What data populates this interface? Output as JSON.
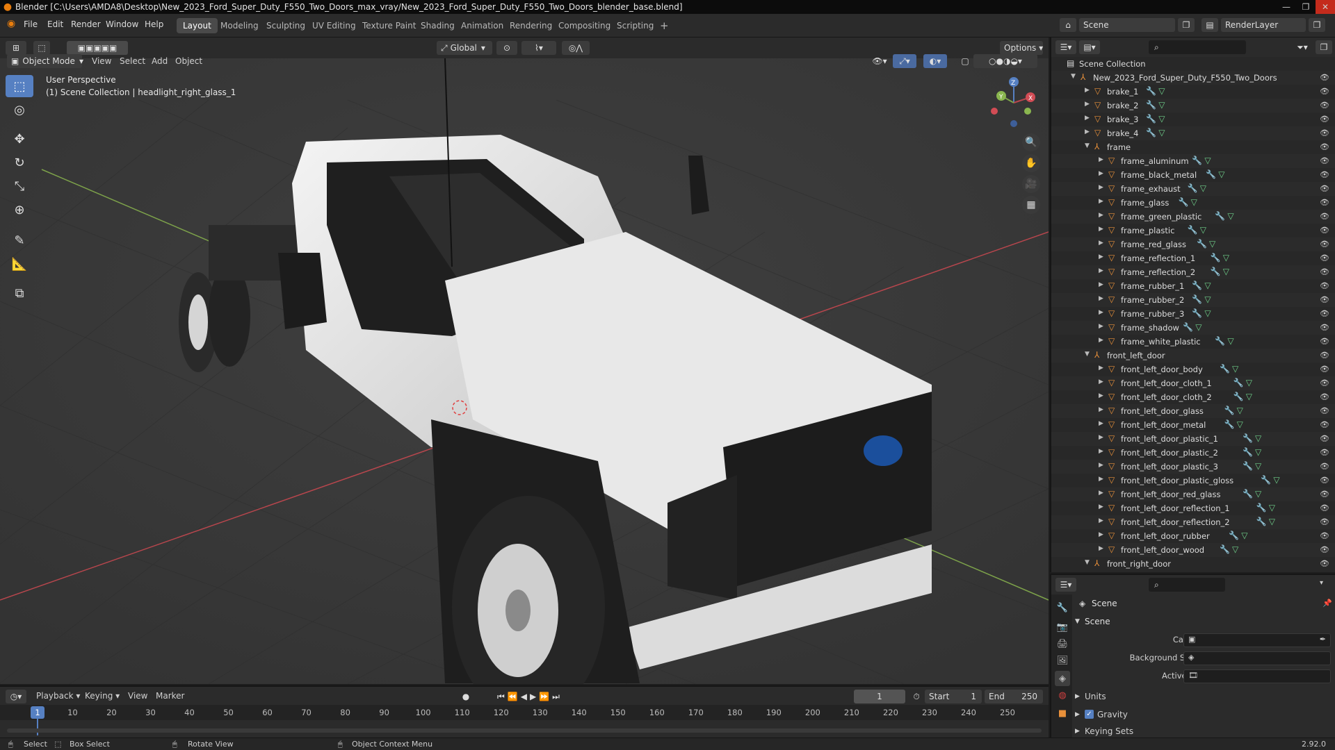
{
  "window": {
    "title": "Blender [C:\\Users\\AMDA8\\Desktop\\New_2023_Ford_Super_Duty_F550_Two_Doors_max_vray/New_2023_Ford_Super_Duty_F550_Two_Doors_blender_base.blend]"
  },
  "menu": [
    "File",
    "Edit",
    "Render",
    "Window",
    "Help"
  ],
  "workspaces": [
    "Layout",
    "Modeling",
    "Sculpting",
    "UV Editing",
    "Texture Paint",
    "Shading",
    "Animation",
    "Rendering",
    "Compositing",
    "Scripting"
  ],
  "active_workspace": "Layout",
  "topright": {
    "scene": "Scene",
    "render_layer": "RenderLayer"
  },
  "viewport_header": {
    "orientation": "Global",
    "options": "Options",
    "mode": "Object Mode",
    "menus": [
      "View",
      "Select",
      "Add",
      "Object"
    ]
  },
  "viewport": {
    "perspective": "User Perspective",
    "context": "(1) Scene Collection | headlight_right_glass_1"
  },
  "gizmo": {
    "x": "X",
    "y": "Y",
    "z": "Z"
  },
  "outliner": {
    "root": "Scene Collection",
    "collection": "New_2023_Ford_Super_Duty_F550_Two_Doors",
    "brakes": [
      "brake_1",
      "brake_2",
      "brake_3",
      "brake_4"
    ],
    "frame": {
      "name": "frame",
      "children": [
        "frame_aluminum",
        "frame_black_metal",
        "frame_exhaust",
        "frame_glass",
        "frame_green_plastic",
        "frame_plastic",
        "frame_red_glass",
        "frame_reflection_1",
        "frame_reflection_2",
        "frame_rubber_1",
        "frame_rubber_2",
        "frame_rubber_3",
        "frame_shadow",
        "frame_white_plastic"
      ]
    },
    "front_left_door": {
      "name": "front_left_door",
      "children": [
        "front_left_door_body",
        "front_left_door_cloth_1",
        "front_left_door_cloth_2",
        "front_left_door_glass",
        "front_left_door_metal",
        "front_left_door_plastic_1",
        "front_left_door_plastic_2",
        "front_left_door_plastic_3",
        "front_left_door_plastic_gloss",
        "front_left_door_red_glass",
        "front_left_door_reflection_1",
        "front_left_door_reflection_2",
        "front_left_door_rubber",
        "front_left_door_wood"
      ]
    },
    "front_right_door": "front_right_door"
  },
  "properties": {
    "header": "Scene",
    "panel": "Scene",
    "camera_label": "Camera",
    "bg_scene_label": "Background Scene",
    "active_clip_label": "Active Clip",
    "units": "Units",
    "gravity": "Gravity",
    "keying_sets": "Keying Sets"
  },
  "timeline": {
    "menus": [
      "Playback",
      "Keying",
      "View",
      "Marker"
    ],
    "current_frame": "1",
    "start_label": "Start",
    "start": "1",
    "end_label": "End",
    "end": "250",
    "ticks": [
      "1",
      "10",
      "20",
      "30",
      "40",
      "50",
      "60",
      "70",
      "80",
      "90",
      "100",
      "110",
      "120",
      "130",
      "140",
      "150",
      "160",
      "170",
      "180",
      "190",
      "200",
      "210",
      "220",
      "230",
      "240",
      "250"
    ]
  },
  "status": {
    "select": "Select",
    "box_select": "Box Select",
    "rotate": "Rotate View",
    "context": "Object Context Menu",
    "version": "2.92.0"
  }
}
